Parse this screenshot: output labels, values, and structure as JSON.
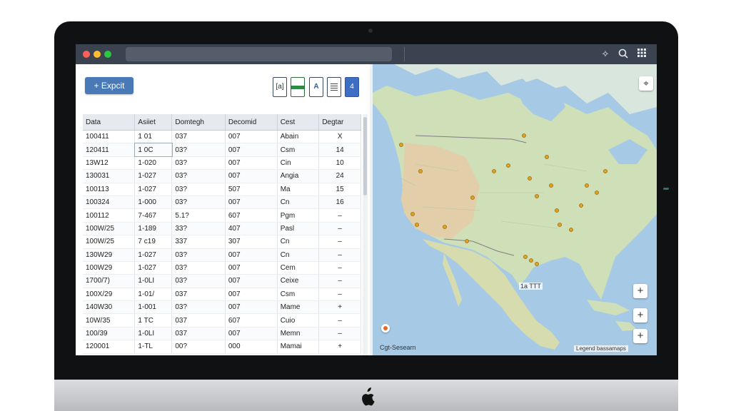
{
  "toolbar": {
    "export_label": "+ Expcit",
    "file_icons": [
      {
        "name": "doc-file-icon",
        "label": "[a]"
      },
      {
        "name": "spreadsheet-file-icon",
        "label": ""
      },
      {
        "name": "text-file-icon",
        "label": "A"
      },
      {
        "name": "list-file-icon",
        "label": ""
      },
      {
        "name": "word-file-icon",
        "label": "4"
      }
    ]
  },
  "table": {
    "columns": [
      "Data",
      "Asiiet",
      "Domtegh",
      "Decomid",
      "Cest",
      "Degtar"
    ],
    "rows": [
      [
        "100411",
        "1 01",
        "037",
        "007",
        "Abain",
        "X"
      ],
      [
        "120411",
        "1 0C",
        "03?",
        "007",
        "Csm",
        "14"
      ],
      [
        "13W12",
        "1-020",
        "03?",
        "007",
        "Cin",
        "10"
      ],
      [
        "130031",
        "1-027",
        "03?",
        "007",
        "Angia",
        "24"
      ],
      [
        "100113",
        "1-027",
        "03?",
        "507",
        "Ma",
        "15"
      ],
      [
        "100324",
        "1-000",
        "03?",
        "007",
        "Cn",
        "16"
      ],
      [
        "100112",
        "7-467",
        "5.1?",
        "607",
        "Pgm",
        "–"
      ],
      [
        "100W/25",
        "1-189",
        "33?",
        "407",
        "Pasl",
        "–"
      ],
      [
        "100W/25",
        "7 c19",
        "337",
        "307",
        "Cn",
        "–"
      ],
      [
        "130W29",
        "1-027",
        "03?",
        "007",
        "Cn",
        "–"
      ],
      [
        "100W29",
        "1-027",
        "03?",
        "007",
        "Cem",
        "–"
      ],
      [
        "1700/7)",
        "1-0LI",
        "03?",
        "007",
        "Ceixe",
        "–"
      ],
      [
        "100X/29",
        "1-01/",
        "037",
        "007",
        "Csm",
        "–"
      ],
      [
        "140W30",
        "1-001",
        "03?",
        "007",
        "Mame",
        "+"
      ],
      [
        "10W/35",
        "1 TC",
        "037",
        "607",
        "Cuio",
        "–"
      ],
      [
        "100/39",
        "1-0LI",
        "037",
        "007",
        "Memn",
        "–"
      ],
      [
        "120001",
        "1-TL",
        "00?",
        "000",
        "Mamai",
        "+"
      ]
    ]
  },
  "map": {
    "label_gulf": "1a TTT",
    "legend_label": "Cgt-Sesearn",
    "attribution": "Legend bassamaps",
    "controls": {
      "locate": "⌖",
      "zoom_in": "+"
    },
    "colors": {
      "water": "#9ec4e4",
      "land": "#cfe0b8",
      "desert": "#e2cfa9",
      "marker": "#e0a020"
    }
  }
}
